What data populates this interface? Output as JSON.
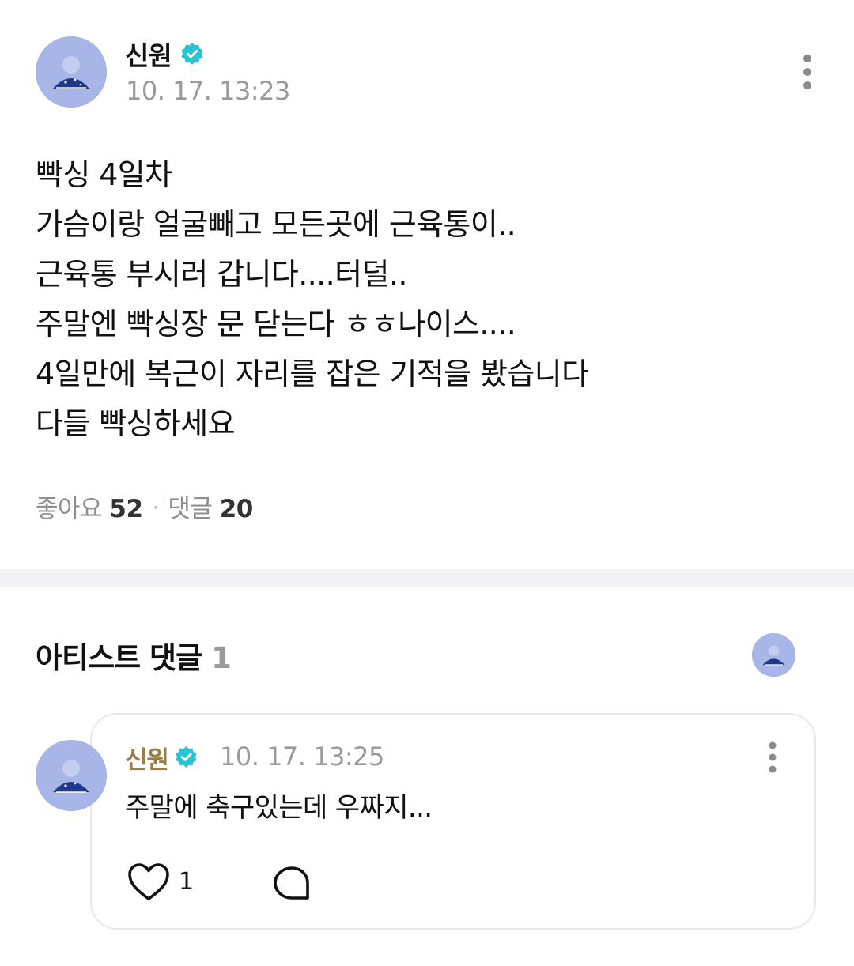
{
  "post": {
    "author": "신원",
    "timestamp": "10. 17. 13:23",
    "body_lines": [
      "빡싱 4일차",
      "가슴이랑 얼굴빼고 모든곳에 근육통이..",
      "근육통 부시러 갑니다....터덜..",
      "주말엔 빡싱장 문 닫는다 ㅎㅎ나이스....",
      "4일만에 복근이 자리를 잡은 기적을 봤습니다",
      "다들 빡싱하세요"
    ],
    "stats": {
      "likes_label": "좋아요",
      "likes_count": "52",
      "separator": "·",
      "comments_label": "댓글",
      "comments_count": "20"
    }
  },
  "artist_comments": {
    "title": "아티스트 댓글",
    "count": "1",
    "comment": {
      "author": "신원",
      "timestamp": "10. 17. 13:25",
      "text": "주말에 축구있는데 우짜지...",
      "like_count": "1"
    }
  },
  "icons": {
    "verified": "verified-badge-icon",
    "more": "more-vertical-icon",
    "like": "heart-icon",
    "reply": "comment-bubble-icon"
  },
  "colors": {
    "verified_badge": "#2bc3d4",
    "avatar_bg": "#a7b6e6",
    "comment_author": "#9b7e45",
    "muted_text": "#9a9a9a",
    "divider": "#f2f2f4"
  }
}
